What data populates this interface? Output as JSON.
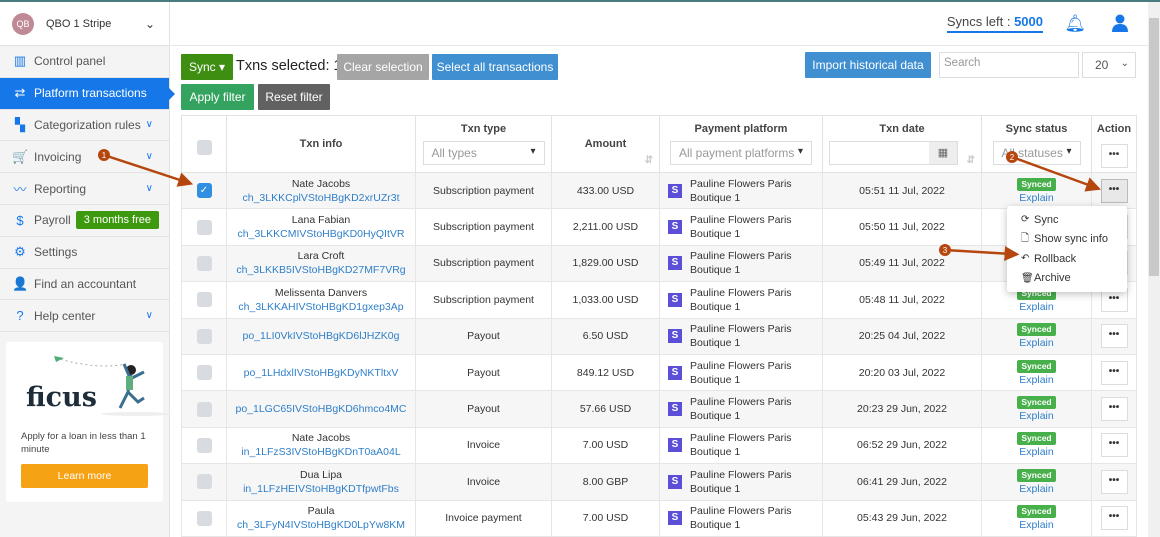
{
  "account": {
    "initials": "QB",
    "name": "QBO 1 Stripe"
  },
  "sidebar": {
    "items": [
      {
        "label": "Control panel",
        "icon": "chart-icon",
        "glyph": "▥"
      },
      {
        "label": "Platform transactions",
        "icon": "arrows-icon",
        "glyph": "⇄",
        "active": true
      },
      {
        "label": "Categorization rules",
        "icon": "tree-icon",
        "glyph": "▚",
        "dropdown": true
      },
      {
        "label": "Invoicing",
        "icon": "cart-icon",
        "glyph": "🛒",
        "dropdown": true
      },
      {
        "label": "Reporting",
        "icon": "trend-icon",
        "glyph": "〰",
        "dropdown": true
      },
      {
        "label": "Payroll",
        "icon": "dollar-icon",
        "glyph": "$",
        "badge": "3 months free"
      },
      {
        "label": "Settings",
        "icon": "gear-icon",
        "glyph": "⚙"
      },
      {
        "label": "Find an accountant",
        "icon": "person-icon",
        "glyph": "👤"
      },
      {
        "label": "Help center",
        "icon": "question-icon",
        "glyph": "?",
        "dropdown": true
      }
    ]
  },
  "promo": {
    "logo": "ficus",
    "text": "Apply for a loan in less than 1 minute",
    "button": "Learn more"
  },
  "header": {
    "syncs_label": "Syncs left : ",
    "syncs_value": "5000"
  },
  "toolbar": {
    "sync": "Sync ▾",
    "selected": "Txns selected: 1",
    "clear": "Clear selection",
    "select_all": "Select all transactions",
    "apply": "Apply filter",
    "reset": "Reset filter",
    "import": "Import historical data",
    "search_placeholder": "Search",
    "per_page": "20"
  },
  "table": {
    "headers": {
      "info": "Txn info",
      "type": "Txn type",
      "amount": "Amount",
      "platform": "Payment platform",
      "date": "Txn date",
      "status": "Sync status",
      "action": "Action"
    },
    "filters": {
      "type": "All types",
      "platform": "All payment platforms",
      "status": "All statuses"
    },
    "rows": [
      {
        "name": "Nate Jacobs",
        "id": "ch_3LKKCplVStoHBgKD2xrUZr3t",
        "type": "Subscription payment",
        "amount": "433.00 USD",
        "platform": "Pauline Flowers Paris Boutique 1",
        "date": "05:51 11 Jul, 2022",
        "status": "Synced",
        "explain": "Explain",
        "checked": true
      },
      {
        "name": "Lana Fabian",
        "id": "ch_3LKKCMIVStoHBgKD0HyQItVR",
        "type": "Subscription payment",
        "amount": "2,211.00 USD",
        "platform": "Pauline Flowers Paris Boutique 1",
        "date": "05:50 11 Jul, 2022",
        "status": "Synced",
        "explain": "Explain"
      },
      {
        "name": "Lara Croft",
        "id": "ch_3LKKB5IVStoHBgKD27MF7VRg",
        "type": "Subscription payment",
        "amount": "1,829.00 USD",
        "platform": "Pauline Flowers Paris Boutique 1",
        "date": "05:49 11 Jul, 2022",
        "status": "Synced",
        "explain": "Explain"
      },
      {
        "name": "Melissenta Danvers",
        "id": "ch_3LKKAHIVStoHBgKD1gxep3Ap",
        "type": "Subscription payment",
        "amount": "1,033.00 USD",
        "platform": "Pauline Flowers Paris Boutique 1",
        "date": "05:48 11 Jul, 2022",
        "status": "Synced",
        "explain": "Explain"
      },
      {
        "name": "",
        "id": "po_1LI0VkIVStoHBgKD6lJHZK0g",
        "type": "Payout",
        "amount": "6.50 USD",
        "platform": "Pauline Flowers Paris Boutique 1",
        "date": "20:25 04 Jul, 2022",
        "status": "Synced",
        "explain": "Explain"
      },
      {
        "name": "",
        "id": "po_1LHdxlIVStoHBgKDyNKTltxV",
        "type": "Payout",
        "amount": "849.12 USD",
        "platform": "Pauline Flowers Paris Boutique 1",
        "date": "20:20 03 Jul, 2022",
        "status": "Synced",
        "explain": "Explain"
      },
      {
        "name": "",
        "id": "po_1LGC65IVStoHBgKD6hmco4MC",
        "type": "Payout",
        "amount": "57.66 USD",
        "platform": "Pauline Flowers Paris Boutique 1",
        "date": "20:23 29 Jun, 2022",
        "status": "Synced",
        "explain": "Explain"
      },
      {
        "name": "Nate Jacobs",
        "id": "in_1LFzS3IVStoHBgKDnT0aA04L",
        "type": "Invoice",
        "amount": "7.00 USD",
        "platform": "Pauline Flowers Paris Boutique 1",
        "date": "06:52 29 Jun, 2022",
        "status": "Synced",
        "explain": "Explain"
      },
      {
        "name": "Dua Lipa",
        "id": "in_1LFzHEIVStoHBgKDTfpwtFbs",
        "type": "Invoice",
        "amount": "8.00 GBP",
        "platform": "Pauline Flowers Paris Boutique 1",
        "date": "06:41 29 Jun, 2022",
        "status": "Synced",
        "explain": "Explain"
      },
      {
        "name": "Paula",
        "id": "ch_3LFyN4IVStoHBgKD0LpYw8KM",
        "type": "Invoice payment",
        "amount": "7.00 USD",
        "platform": "Pauline Flowers Paris Boutique 1",
        "date": "05:43 29 Jun, 2022",
        "status": "Synced",
        "explain": "Explain"
      }
    ]
  },
  "action_menu": [
    {
      "label": "Sync",
      "glyph": "⟳"
    },
    {
      "label": "Show sync info",
      "glyph": "🗋"
    },
    {
      "label": "Rollback",
      "glyph": "↶"
    },
    {
      "label": "Archive",
      "glyph": "🗑"
    }
  ],
  "annotations": [
    "1",
    "2",
    "3"
  ],
  "colors": {
    "accent": "#1677e8",
    "green": "#47b04b",
    "annotation": "#b5470e"
  }
}
